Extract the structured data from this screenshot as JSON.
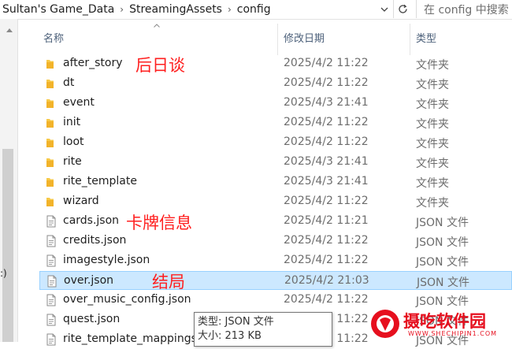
{
  "address": {
    "crumbs": [
      "Sultan's Game_Data",
      "StreamingAssets",
      "config"
    ],
    "search_placeholder": "在 config 中搜索"
  },
  "nav": {
    "drive_label": ":)"
  },
  "columns": {
    "name": "名称",
    "date": "修改日期",
    "type": "类型"
  },
  "rows": [
    {
      "name": "after_story",
      "date": "2025/4/2 11:22",
      "type": "文件夹",
      "kind": "folder"
    },
    {
      "name": "dt",
      "date": "2025/4/2 11:22",
      "type": "文件夹",
      "kind": "folder"
    },
    {
      "name": "event",
      "date": "2025/4/3 21:41",
      "type": "文件夹",
      "kind": "folder"
    },
    {
      "name": "init",
      "date": "2025/4/2 11:22",
      "type": "文件夹",
      "kind": "folder"
    },
    {
      "name": "loot",
      "date": "2025/4/2 11:22",
      "type": "文件夹",
      "kind": "folder"
    },
    {
      "name": "rite",
      "date": "2025/4/3 21:41",
      "type": "文件夹",
      "kind": "folder"
    },
    {
      "name": "rite_template",
      "date": "2025/4/3 21:41",
      "type": "文件夹",
      "kind": "folder"
    },
    {
      "name": "wizard",
      "date": "2025/4/2 11:22",
      "type": "文件夹",
      "kind": "folder"
    },
    {
      "name": "cards.json",
      "date": "2025/4/2 11:21",
      "type": "JSON 文件",
      "kind": "file"
    },
    {
      "name": "credits.json",
      "date": "2025/4/2 11:22",
      "type": "JSON 文件",
      "kind": "file"
    },
    {
      "name": "imagestyle.json",
      "date": "2025/4/2 11:22",
      "type": "JSON 文件",
      "kind": "file"
    },
    {
      "name": "over.json",
      "date": "2025/4/2 21:03",
      "type": "JSON 文件",
      "kind": "file",
      "selected": true
    },
    {
      "name": "over_music_config.json",
      "date": "2025/4/2 11:22",
      "type": "JSON 文件",
      "kind": "file"
    },
    {
      "name": "quest.json",
      "date": "2025/4/2 11:22",
      "type": "JSON 文件",
      "kind": "file"
    },
    {
      "name": "rite_template_mappings",
      "date": "2025/4/2 11:22",
      "type": "JSON 文件",
      "kind": "file"
    }
  ],
  "annotations": {
    "after_story": "后日谈",
    "cards": "卡牌信息",
    "over": "结局"
  },
  "tooltip": {
    "line1": "类型: JSON 文件",
    "line2": "大小: 213 KB"
  },
  "watermark": {
    "text": "摄吃软件园",
    "sub": "WWW.SHECHIPIN1.COM"
  },
  "colors": {
    "folder": "#f7c948",
    "selection": "#cce8ff",
    "annotation": "#ff1f1f",
    "watermark": "#e60f1e"
  }
}
